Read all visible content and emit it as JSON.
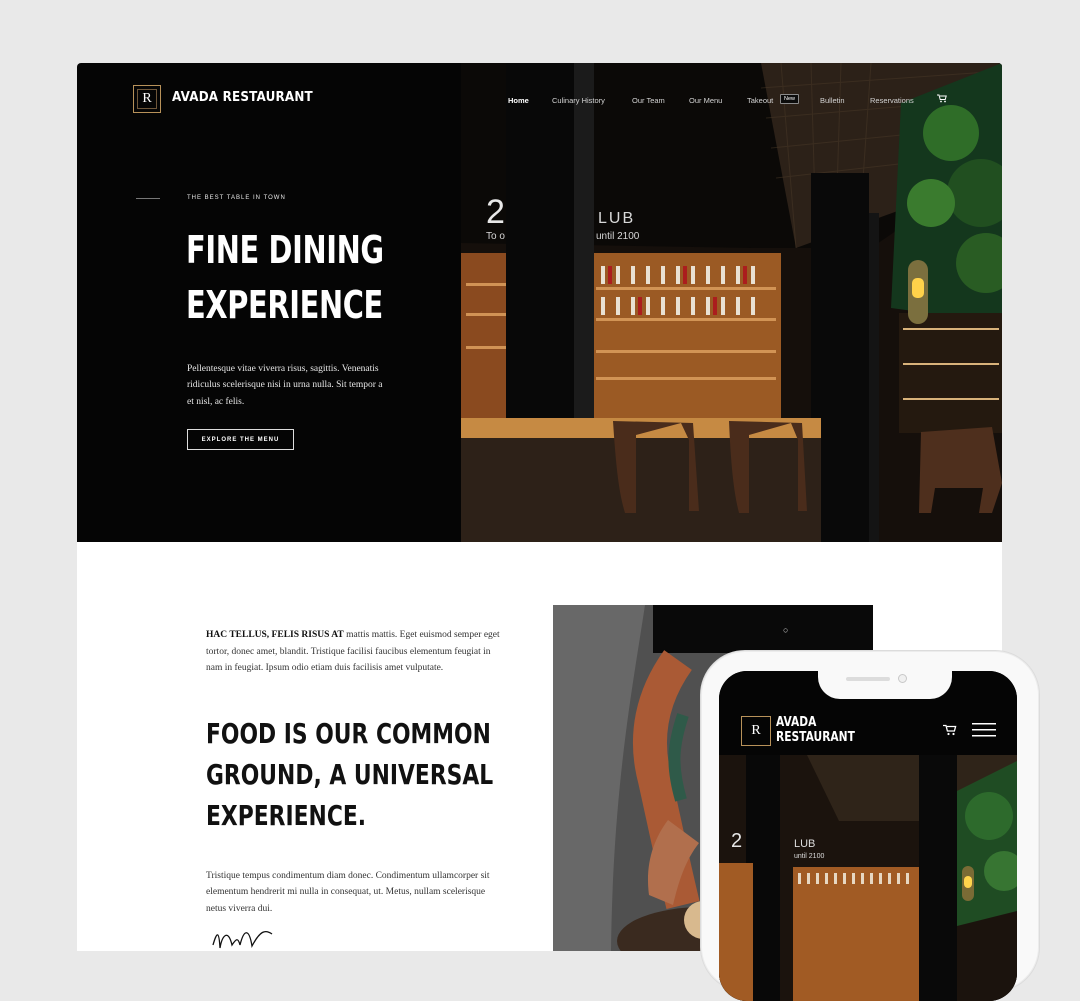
{
  "site": {
    "logo_letter": "R",
    "logo_text": "AVADA RESTAURANT",
    "nav": {
      "items": [
        "Home",
        "Culinary History",
        "Our Team",
        "Our Menu",
        "Takeout",
        "Bulletin",
        "Reservations"
      ],
      "takeout_badge": "New",
      "cart_icon": "cart-icon"
    },
    "hero": {
      "tagline": "THE BEST TABLE IN TOWN",
      "title_line1": "FINE DINING",
      "title_line2": "EXPERIENCE",
      "paragraph": "Pellentesque vitae viverra risus, sagittis. Venenatis ridiculus scelerisque nisi in urna nulla. Sit tempor a et nisl, ac felis.",
      "button": "EXPLORE THE MENU"
    },
    "intro": {
      "lead_bold": "HAC TELLUS, FELIS RISUS AT",
      "lead_text": " mattis mattis. Eget euismod semper eget tortor, donec amet, blandit. Tristique facilisi faucibus elementum feugiat in nam in feugiat. Ipsum odio etiam duis facilisis amet vulputate.",
      "heading_line1": "FOOD IS OUR COMMON",
      "heading_line2": "GROUND, A UNIVERSAL",
      "heading_line3": "EXPERIENCE.",
      "paragraph": "Tristique tempus condimentum diam donec. Condimentum ullamcorper sit elementum hendrerit mi nulla in consequat, ut. Metus, nullam scelerisque netus viverra dui."
    }
  },
  "mobile": {
    "logo_letter": "R",
    "logo_line1": "AVADA",
    "logo_line2": "RESTAURANT",
    "cart_icon": "cart-icon",
    "menu_icon": "hamburger-menu-icon"
  },
  "colors": {
    "page_bg": "#e9e9e9",
    "hero_bg": "#050505",
    "gold": "#b8925a",
    "text_dark": "#111111"
  }
}
